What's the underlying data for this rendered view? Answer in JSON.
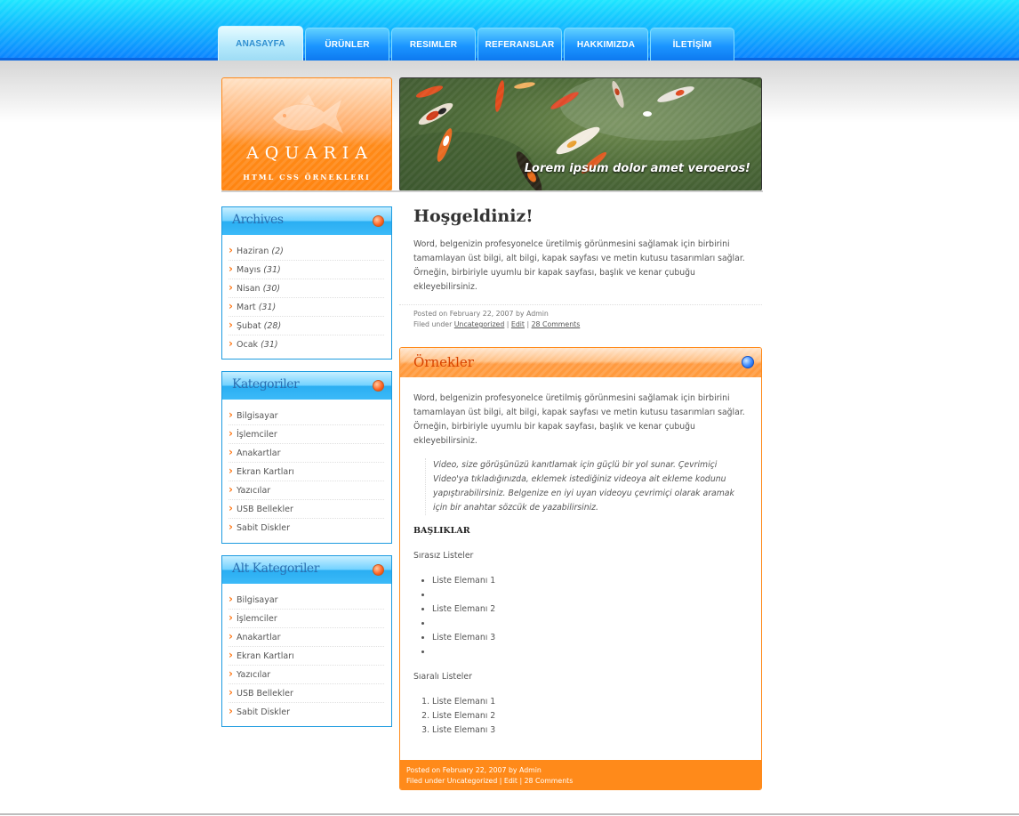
{
  "nav": {
    "tabs": [
      {
        "label": "ANASAYFA",
        "active": true
      },
      {
        "label": "ÜRÜNLER"
      },
      {
        "label": "RESIMLER"
      },
      {
        "label": "REFERANSLAR"
      },
      {
        "label": "HAKKIMIZDA"
      },
      {
        "label": "İLETİŞİM"
      }
    ]
  },
  "logo": {
    "title": "AQUARIA",
    "subtitle": "HTML CSS ÖRNEKLERI"
  },
  "banner": {
    "caption": "Lorem ipsum dolor amet veroeros!"
  },
  "sidebar": {
    "archives": {
      "title": "Archives",
      "items": [
        {
          "label": "Haziran",
          "count": "(2)"
        },
        {
          "label": "Mayıs",
          "count": "(31)"
        },
        {
          "label": "Nisan",
          "count": "(30)"
        },
        {
          "label": "Mart",
          "count": "(31)"
        },
        {
          "label": "Şubat",
          "count": "(28)"
        },
        {
          "label": "Ocak",
          "count": "(31)"
        }
      ]
    },
    "categories": {
      "title": "Kategoriler",
      "items": [
        "Bilgisayar",
        "İşlemciler",
        "Anakartlar",
        "Ekran Kartları",
        "Yazıcılar",
        "USB Bellekler",
        "Sabit Diskler"
      ]
    },
    "subcategories": {
      "title": "Alt Kategoriler",
      "items": [
        "Bilgisayar",
        "İşlemciler",
        "Anakartlar",
        "Ekran Kartları",
        "Yazıcılar",
        "USB Bellekler",
        "Sabit Diskler"
      ]
    }
  },
  "welcome": {
    "title": "Hoşgeldiniz!",
    "text": "Word, belgenizin profesyonelce üretilmiş görünmesini sağlamak için birbirini tamamlayan üst bilgi, alt bilgi, kapak sayfası ve metin kutusu tasarımları sağlar. Örneğin, birbiriyle uyumlu bir kapak sayfası, başlık ve kenar çubuğu ekleyebilirsiniz.",
    "posted": "Posted on February 22, 2007 by Admin",
    "filed_prefix": "Filed under",
    "category_link": "Uncategorized",
    "edit_link": "Edit",
    "comments_link": "28 Comments"
  },
  "examples": {
    "title": "Örnekler",
    "text": "Word, belgenizin profesyonelce üretilmiş görünmesini sağlamak için birbirini tamamlayan üst bilgi, alt bilgi, kapak sayfası ve metin kutusu tasarımları sağlar. Örneğin, birbiriyle uyumlu bir kapak sayfası, başlık ve kenar çubuğu ekleyebilirsiniz.",
    "quote": "Video, size görüşünüzü kanıtlamak için güçlü bir yol sunar. Çevrimiçi Video'ya tıkladığınızda, eklemek istediğiniz videoya ait ekleme kodunu yapıştırabilirsiniz. Belgenize en iyi uyan videoyu çevrimiçi olarak aramak için bir anahtar sözcük de yazabilirsiniz.",
    "heading": "BAŞLIKLAR",
    "unordered_title": "Sırasız Listeler",
    "unordered_items": [
      "Liste Elemanı 1",
      "",
      "Liste Elemanı 2",
      "",
      "Liste Elemanı 3",
      ""
    ],
    "ordered_title": "Sıaralı Listeler",
    "ordered_items": [
      "Liste Elemanı 1",
      "Liste Elemanı 2",
      "Liste Elemanı 3"
    ],
    "posted": "Posted on February 22, 2007 by Admin",
    "filed_prefix": "Filed under",
    "category_link": "Uncategorized",
    "edit_link": "Edit",
    "comments_link": "28 Comments"
  },
  "colors": {
    "primary_blue": "#13b9ff",
    "accent_orange": "#ff8a1a"
  }
}
